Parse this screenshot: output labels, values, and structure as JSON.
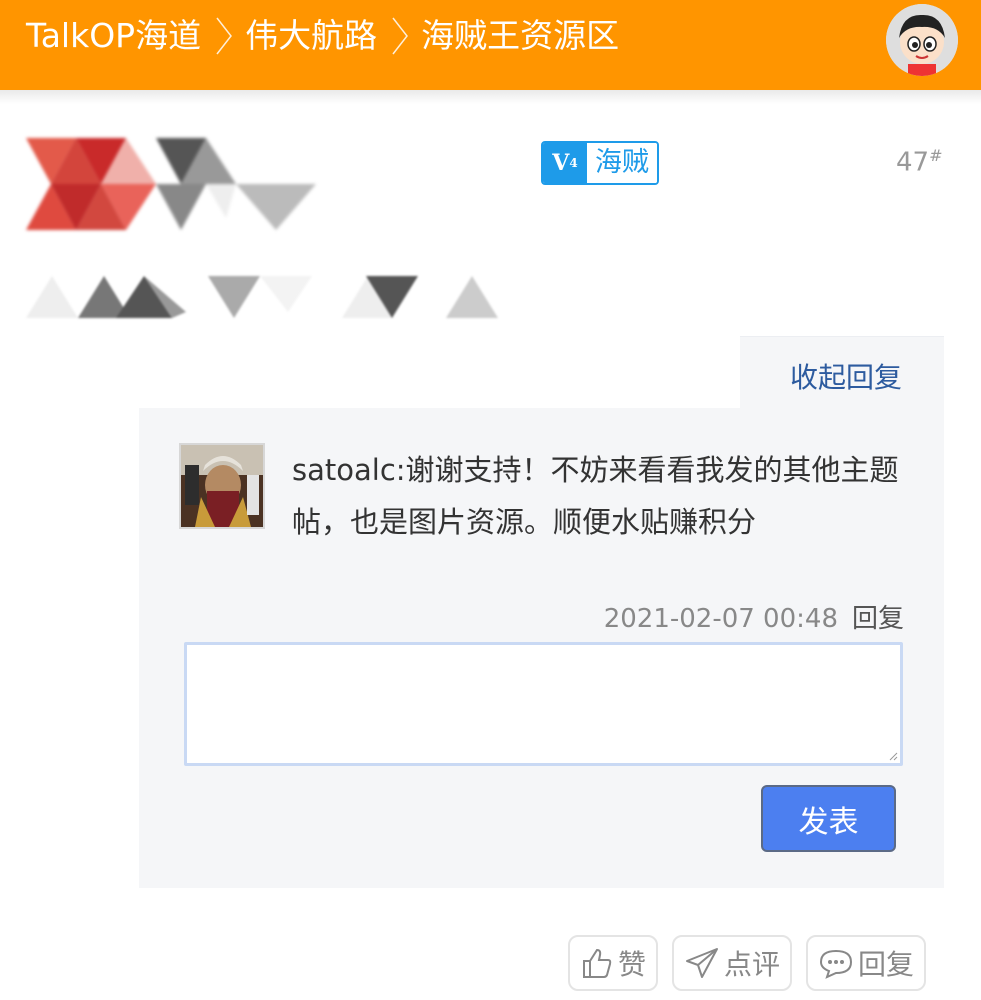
{
  "header": {
    "breadcrumbs": [
      "TalkOP海道",
      "伟大航路",
      "海贼王资源区"
    ],
    "bg_color": "#ff9500"
  },
  "post": {
    "badge_icon_text": "V",
    "badge_level": "4",
    "badge_label": "海贼",
    "floor_number": "47",
    "floor_mark": "#"
  },
  "reply_section": {
    "collapse_label": "收起回复",
    "reply": {
      "text": "satoalc:谢谢支持！不妨来看看我发的其他主题帖，也是图片资源。顺便水贴赚积分",
      "timestamp": "2021-02-07 00:48",
      "reply_link": "回复"
    },
    "input_value": "",
    "submit_label": "发表"
  },
  "actions": {
    "like_label": "赞",
    "comment_label": "点评",
    "reply_label": "回复"
  },
  "colors": {
    "accent": "#ff9500",
    "link": "#2d5b9f",
    "button": "#4c7ff0",
    "badge": "#1e9be9"
  }
}
